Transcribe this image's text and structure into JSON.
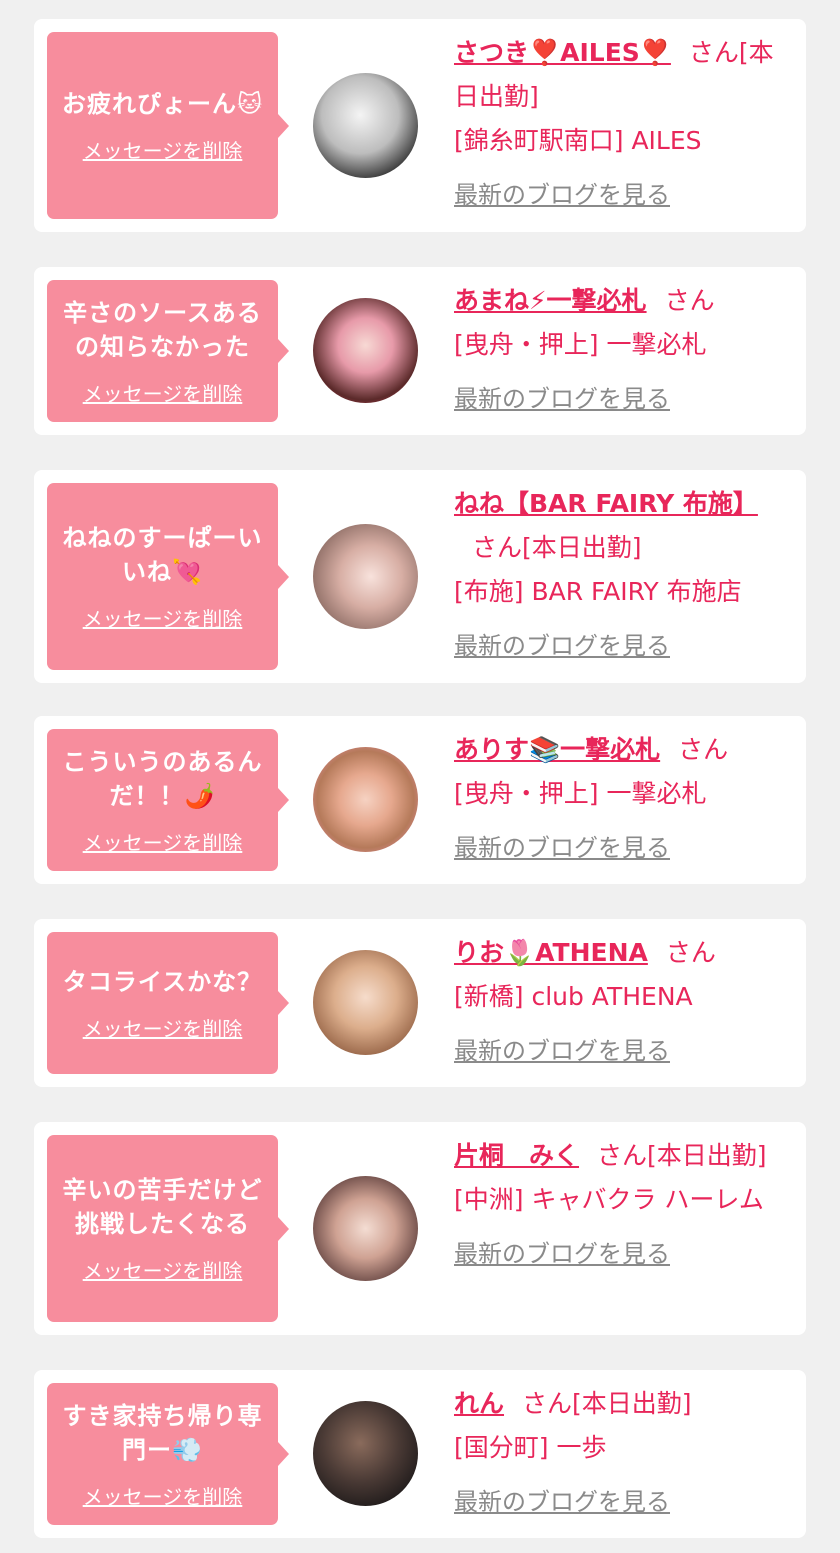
{
  "colors": {
    "page_bg": "#f0f0f0",
    "card_bg": "#ffffff",
    "bubble_bg": "#f78d9d",
    "name_color": "#e8265a",
    "link_gray": "#8a8a8a"
  },
  "items": [
    {
      "message": "お疲れぴょーん🐱",
      "delete_label": "メッセージを削除",
      "name": "さつき❣️AILES❣️",
      "suffix": "さん[本日出勤]",
      "shop": "[錦糸町駅南口] AILES",
      "blog_label": "最新のブログを見る",
      "avatar_icon": "avatar-photo"
    },
    {
      "message": "辛さのソースあるの知らなかった",
      "delete_label": "メッセージを削除",
      "name": "あまね⚡一撃必札",
      "suffix": "さん",
      "shop": "[曳舟・押上] 一撃必札",
      "blog_label": "最新のブログを見る",
      "avatar_icon": "avatar-photo"
    },
    {
      "message": "ねねのすーぱーいいね💘",
      "delete_label": "メッセージを削除",
      "name": "ねね【BAR FAIRY 布施】",
      "suffix": "さん[本日出勤]",
      "shop": "[布施] BAR FAIRY 布施店",
      "blog_label": "最新のブログを見る",
      "avatar_icon": "avatar-photo"
    },
    {
      "message": "こういうのあるんだ！！🌶️",
      "delete_label": "メッセージを削除",
      "name": "ありす📚一撃必札",
      "suffix": "さん",
      "shop": "[曳舟・押上] 一撃必札",
      "blog_label": "最新のブログを見る",
      "avatar_icon": "avatar-photo"
    },
    {
      "message": "タコライスかな？",
      "delete_label": "メッセージを削除",
      "name": "りお🌷ATHENA",
      "suffix": "さん",
      "shop": "[新橋] club ATHENA",
      "blog_label": "最新のブログを見る",
      "avatar_icon": "avatar-photo"
    },
    {
      "message": "辛いの苦手だけど挑戦したくなる",
      "delete_label": "メッセージを削除",
      "name": "片桐　みく",
      "suffix": "さん[本日出勤]",
      "shop": "[中洲] キャバクラ ハーレム",
      "blog_label": "最新のブログを見る",
      "avatar_icon": "avatar-photo"
    },
    {
      "message": "すき家持ち帰り専門ー💨",
      "delete_label": "メッセージを削除",
      "name": "れん",
      "suffix": "さん[本日出勤]",
      "shop": "[国分町] 一歩",
      "blog_label": "最新のブログを見る",
      "avatar_icon": "avatar-photo"
    }
  ]
}
